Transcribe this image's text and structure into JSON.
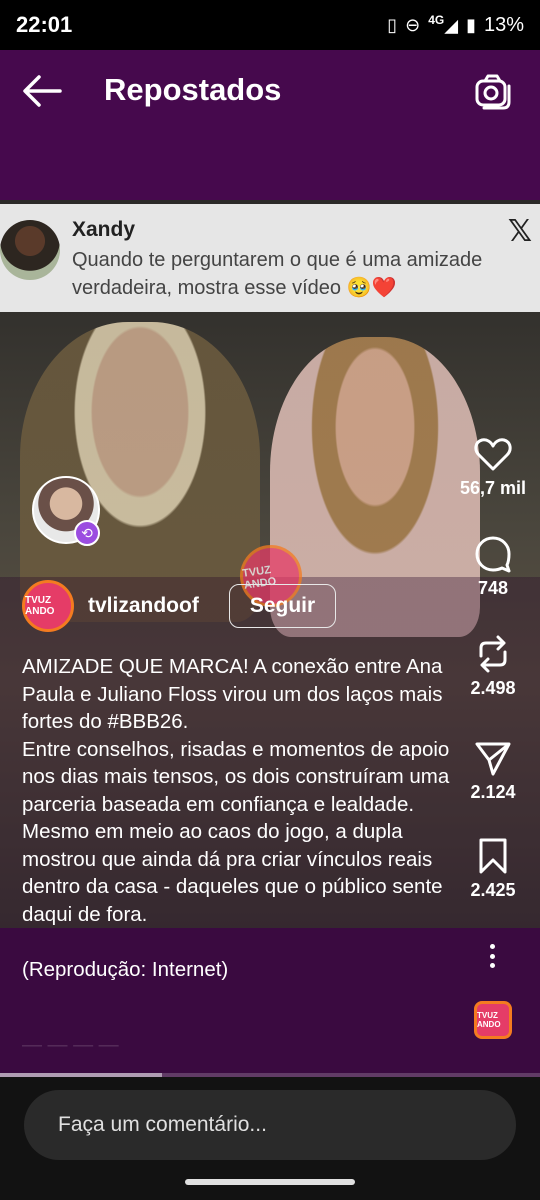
{
  "status_bar": {
    "time": "22:01",
    "network": "4G",
    "battery": "13%"
  },
  "header": {
    "title": "Repostados"
  },
  "tweet": {
    "user": "Xandy",
    "text": "Quando te perguntarem o que é uma amizade verdadeira, mostra esse vídeo 🥹❤️"
  },
  "watermark_text": "TVUZ ANDO",
  "author": {
    "username": "tvlizandoof",
    "follow_label": "Seguir"
  },
  "caption": {
    "text": "AMIZADE QUE MARCA! A conexão entre Ana Paula e Juliano Floss virou um dos laços mais fortes do #BBB26.\nEntre conselhos, risadas e momentos de apoio nos dias mais tensos, os dois construíram uma parceria baseada em confiança e lealdade.\nMesmo em meio ao caos do jogo, a dupla mostrou que ainda dá pra criar vínculos reais dentro da casa - daqueles que o público sente daqui de fora.\n\n(Reprodução: Internet)"
  },
  "actions": {
    "likes": "56,7 mil",
    "comments": "748",
    "reposts": "2.498",
    "shares": "2.124",
    "saves": "2.425"
  },
  "progress": {
    "fraction": 0.3
  },
  "comment": {
    "placeholder": "Faça um comentário..."
  }
}
